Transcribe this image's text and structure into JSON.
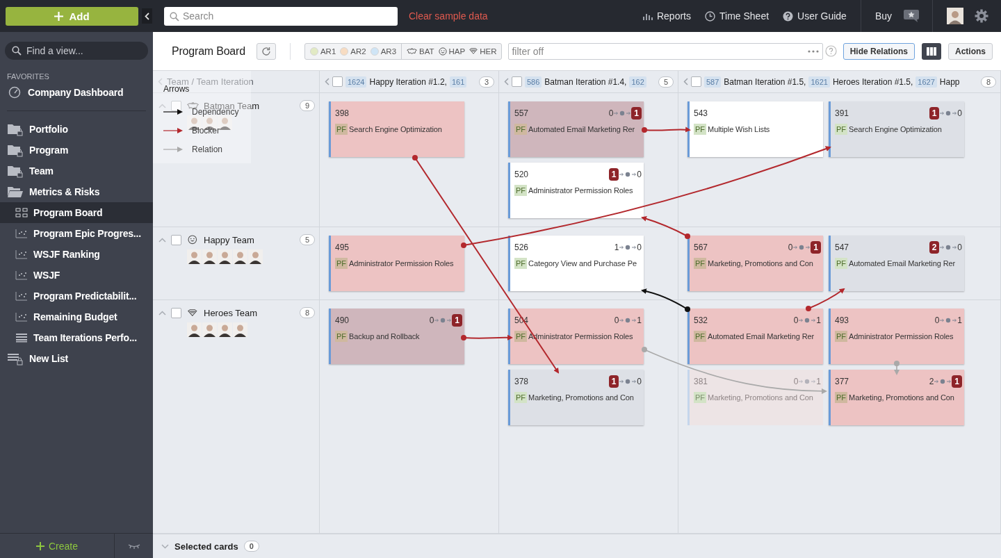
{
  "sidebar": {
    "add_button": "Add",
    "find_placeholder": "Find a view...",
    "favorites_label": "FAVORITES",
    "favorites": [
      {
        "label": "Company Dashboard",
        "kind": "gauge",
        "selected": false
      }
    ],
    "items": [
      {
        "label": "Portfolio",
        "kind": "locked-folder",
        "selected": false
      },
      {
        "label": "Program",
        "kind": "locked-folder",
        "selected": false
      },
      {
        "label": "Team",
        "kind": "locked-folder",
        "selected": false
      },
      {
        "label": "Metrics & Risks",
        "kind": "folder",
        "selected": false,
        "children": [
          {
            "label": "Program Board",
            "kind": "board",
            "selected": true
          },
          {
            "label": "Program Epic Progres...",
            "kind": "chart",
            "selected": false
          },
          {
            "label": "WSJF Ranking",
            "kind": "chart",
            "selected": false
          },
          {
            "label": "WSJF",
            "kind": "chart",
            "selected": false
          },
          {
            "label": "Program Predictabilit...",
            "kind": "chart",
            "selected": false
          },
          {
            "label": "Remaining Budget",
            "kind": "chart",
            "selected": false
          },
          {
            "label": "Team Iterations Perfo...",
            "kind": "list",
            "selected": false
          }
        ]
      },
      {
        "label": "New List",
        "kind": "locked-list",
        "selected": false
      }
    ],
    "create_button": "Create"
  },
  "topbar": {
    "search_placeholder": "Search",
    "clear_link": "Clear sample data",
    "nav": [
      {
        "label": "Reports",
        "kind": "bars"
      },
      {
        "label": "Time Sheet",
        "kind": "clock"
      },
      {
        "label": "User Guide",
        "kind": "help"
      }
    ],
    "buy": "Buy"
  },
  "toolbar": {
    "title": "Program Board",
    "filter_groups": [
      [
        {
          "label": "AR1",
          "kind": "dot",
          "color": "#e2eac4"
        },
        {
          "label": "AR2",
          "kind": "dot",
          "color": "#f7dcc2"
        },
        {
          "label": "AR3",
          "kind": "dot",
          "color": "#cfe5f6"
        }
      ],
      [
        {
          "label": "BAT",
          "kind": "bat"
        },
        {
          "label": "HAP",
          "kind": "smile"
        },
        {
          "label": "HER",
          "kind": "shield"
        }
      ]
    ],
    "filter_placeholder": "filter off",
    "hide_relations": "Hide Relations",
    "actions": "Actions"
  },
  "board": {
    "corner_label": "Team / Team Iteration",
    "columns": [
      {
        "checked": false,
        "iterations": [
          {
            "id": "1624",
            "name": "Happy Iteration #1.2,"
          },
          {
            "id": "161"
          }
        ],
        "count": "3"
      },
      {
        "checked": false,
        "iterations": [
          {
            "id": "586",
            "name": "Batman Iteration #1.4,"
          },
          {
            "id": "162"
          }
        ],
        "count": "5"
      },
      {
        "checked": false,
        "iterations": [
          {
            "id": "587",
            "name": "Batman Iteration #1.5,"
          },
          {
            "id": "1621",
            "name": "Heroes Iteration #1.5,"
          },
          {
            "id": "1627",
            "name": "Happ"
          }
        ],
        "count": "8"
      }
    ],
    "teams": [
      {
        "name": "Batman Team",
        "kind": "bat",
        "checked": false,
        "count": "9",
        "members": [
          {
            "kind": "avatar"
          },
          {
            "kind": "avatar"
          },
          {
            "kind": "avatar"
          }
        ],
        "cells": [
          [
            [
              {
                "id": "398",
                "title": "Search Engine Optimization",
                "color": "#edc3c3",
                "disabled": false,
                "tag": {
                  "text": "PF",
                  "color": "#cfb89f"
                }
              }
            ]
          ],
          [
            [
              {
                "id": "557",
                "title": "Automated Email Marketing Rer",
                "color": "#cfb6bc",
                "disabled": false,
                "tag": {
                  "text": "PF",
                  "color": "#cfb89f"
                },
                "deps": {
                  "in": {
                    "text": "0",
                    "flag": false
                  },
                  "out": {
                    "text": "1",
                    "flag": true
                  }
                }
              },
              {
                "id": "520",
                "title": "Administrator Permission Roles",
                "color": "#ffffff",
                "disabled": false,
                "tag": {
                  "text": "PF",
                  "color": "#d3e3c6"
                },
                "deps": {
                  "in": {
                    "text": "1",
                    "flag": true
                  },
                  "out": {
                    "text": "0",
                    "flag": false
                  }
                }
              }
            ]
          ],
          [
            [
              {
                "id": "543",
                "title": "Multiple Wish Lists",
                "color": "#ffffff",
                "disabled": false,
                "tag": {
                  "text": "PF",
                  "color": "#d3e3c6"
                }
              }
            ],
            [
              {
                "id": "391",
                "title": "Search Engine Optimization",
                "color": "#dde0e6",
                "disabled": false,
                "tag": {
                  "text": "PF",
                  "color": "#d3e3c6"
                },
                "deps": {
                  "in": {
                    "text": "1",
                    "flag": true
                  },
                  "out": {
                    "text": "0",
                    "flag": false
                  }
                }
              }
            ]
          ]
        ]
      },
      {
        "name": "Happy Team",
        "kind": "smile",
        "checked": false,
        "count": "5",
        "members": [
          {
            "kind": "avatar"
          },
          {
            "kind": "avatar"
          },
          {
            "kind": "avatar"
          },
          {
            "kind": "avatar"
          },
          {
            "kind": "avatar"
          }
        ],
        "cells": [
          [
            [
              {
                "id": "495",
                "title": "Administrator Permission Roles",
                "color": "#edc3c3",
                "disabled": false,
                "tag": {
                  "text": "PF",
                  "color": "#cfb89f"
                }
              }
            ]
          ],
          [
            [
              {
                "id": "526",
                "title": "Category View and Purchase Pe",
                "color": "#ffffff",
                "disabled": false,
                "tag": {
                  "text": "PF",
                  "color": "#d3e3c6"
                },
                "deps": {
                  "in": {
                    "text": "1",
                    "flag": false
                  },
                  "out": {
                    "text": "0",
                    "flag": false
                  }
                }
              }
            ]
          ],
          [
            [
              {
                "id": "567",
                "title": "Marketing, Promotions and Con",
                "color": "#edc3c3",
                "disabled": false,
                "tag": {
                  "text": "PF",
                  "color": "#cfb89f"
                },
                "deps": {
                  "in": {
                    "text": "0",
                    "flag": false
                  },
                  "out": {
                    "text": "1",
                    "flag": true
                  }
                }
              }
            ],
            [
              {
                "id": "547",
                "title": "Automated Email Marketing Rer",
                "color": "#dde0e6",
                "disabled": false,
                "tag": {
                  "text": "PF",
                  "color": "#d3e3c6"
                },
                "deps": {
                  "in": {
                    "text": "2",
                    "flag": true
                  },
                  "out": {
                    "text": "0",
                    "flag": false
                  }
                }
              }
            ]
          ]
        ]
      },
      {
        "name": "Heroes Team",
        "kind": "shield",
        "checked": false,
        "count": "8",
        "members": [
          {
            "kind": "avatar"
          },
          {
            "kind": "avatar"
          },
          {
            "kind": "avatar"
          },
          {
            "kind": "avatar"
          }
        ],
        "cells": [
          [
            [
              {
                "id": "490",
                "title": "Backup and Rollback",
                "color": "#cfb6bc",
                "disabled": false,
                "tag": {
                  "text": "PF",
                  "color": "#cfb89f"
                },
                "deps": {
                  "in": {
                    "text": "0",
                    "flag": false
                  },
                  "out": {
                    "text": "1",
                    "flag": true
                  }
                }
              }
            ]
          ],
          [
            [
              {
                "id": "504",
                "title": "Administrator Permission Roles",
                "color": "#edc3c3",
                "disabled": false,
                "tag": {
                  "text": "PF",
                  "color": "#cfb89f"
                },
                "deps": {
                  "in": {
                    "text": "0",
                    "flag": false
                  },
                  "out": {
                    "text": "1",
                    "flag": false
                  }
                }
              },
              {
                "id": "378",
                "title": "Marketing, Promotions and Con",
                "color": "#dde0e6",
                "disabled": false,
                "tag": {
                  "text": "PF",
                  "color": "#d3e3c6"
                },
                "deps": {
                  "in": {
                    "text": "1",
                    "flag": true
                  },
                  "out": {
                    "text": "0",
                    "flag": false
                  }
                }
              }
            ]
          ],
          [
            [
              {
                "id": "532",
                "title": "Automated Email Marketing Rer",
                "color": "#edc3c3",
                "disabled": false,
                "tag": {
                  "text": "PF",
                  "color": "#cfb89f"
                },
                "deps": {
                  "in": {
                    "text": "0",
                    "flag": false
                  },
                  "out": {
                    "text": "1",
                    "flag": false
                  }
                }
              },
              {
                "id": "381",
                "title": "Marketing, Promotions and Con",
                "color": "#ede4e5",
                "disabled": true,
                "tag": {
                  "text": "PF",
                  "color": "#d3e3c6"
                },
                "deps": {
                  "in": {
                    "text": "0",
                    "flag": false
                  },
                  "out": {
                    "text": "1",
                    "flag": false
                  }
                }
              }
            ],
            [
              {
                "id": "493",
                "title": "Administrator Permission Roles",
                "color": "#edc3c3",
                "disabled": false,
                "tag": {
                  "text": "PF",
                  "color": "#cfb89f"
                },
                "deps": {
                  "in": {
                    "text": "0",
                    "flag": false
                  },
                  "out": {
                    "text": "1",
                    "flag": false
                  }
                }
              },
              {
                "id": "377",
                "title": "Marketing, Promotions and Con",
                "color": "#edc3c3",
                "disabled": false,
                "tag": {
                  "text": "PF",
                  "color": "#cfb89f"
                },
                "deps": {
                  "in": {
                    "text": "2",
                    "flag": false
                  },
                  "out": {
                    "text": "1",
                    "flag": true
                  }
                }
              }
            ]
          ]
        ]
      }
    ]
  },
  "legend": {
    "title": "Arrows",
    "items": [
      {
        "label": "Dependency",
        "kind": "dependency"
      },
      {
        "label": "Blocker",
        "kind": "blocker"
      },
      {
        "label": "Relation",
        "kind": "relation"
      }
    ]
  },
  "relations": [
    {
      "kind": "blocker"
    },
    {
      "kind": "blocker"
    },
    {
      "kind": "blocker"
    },
    {
      "kind": "blocker"
    },
    {
      "kind": "dependency"
    },
    {
      "kind": "blocker"
    },
    {
      "kind": "blocker"
    },
    {
      "kind": "relation"
    },
    {
      "kind": "relation"
    }
  ],
  "footer": {
    "label": "Selected cards",
    "count": "0"
  }
}
